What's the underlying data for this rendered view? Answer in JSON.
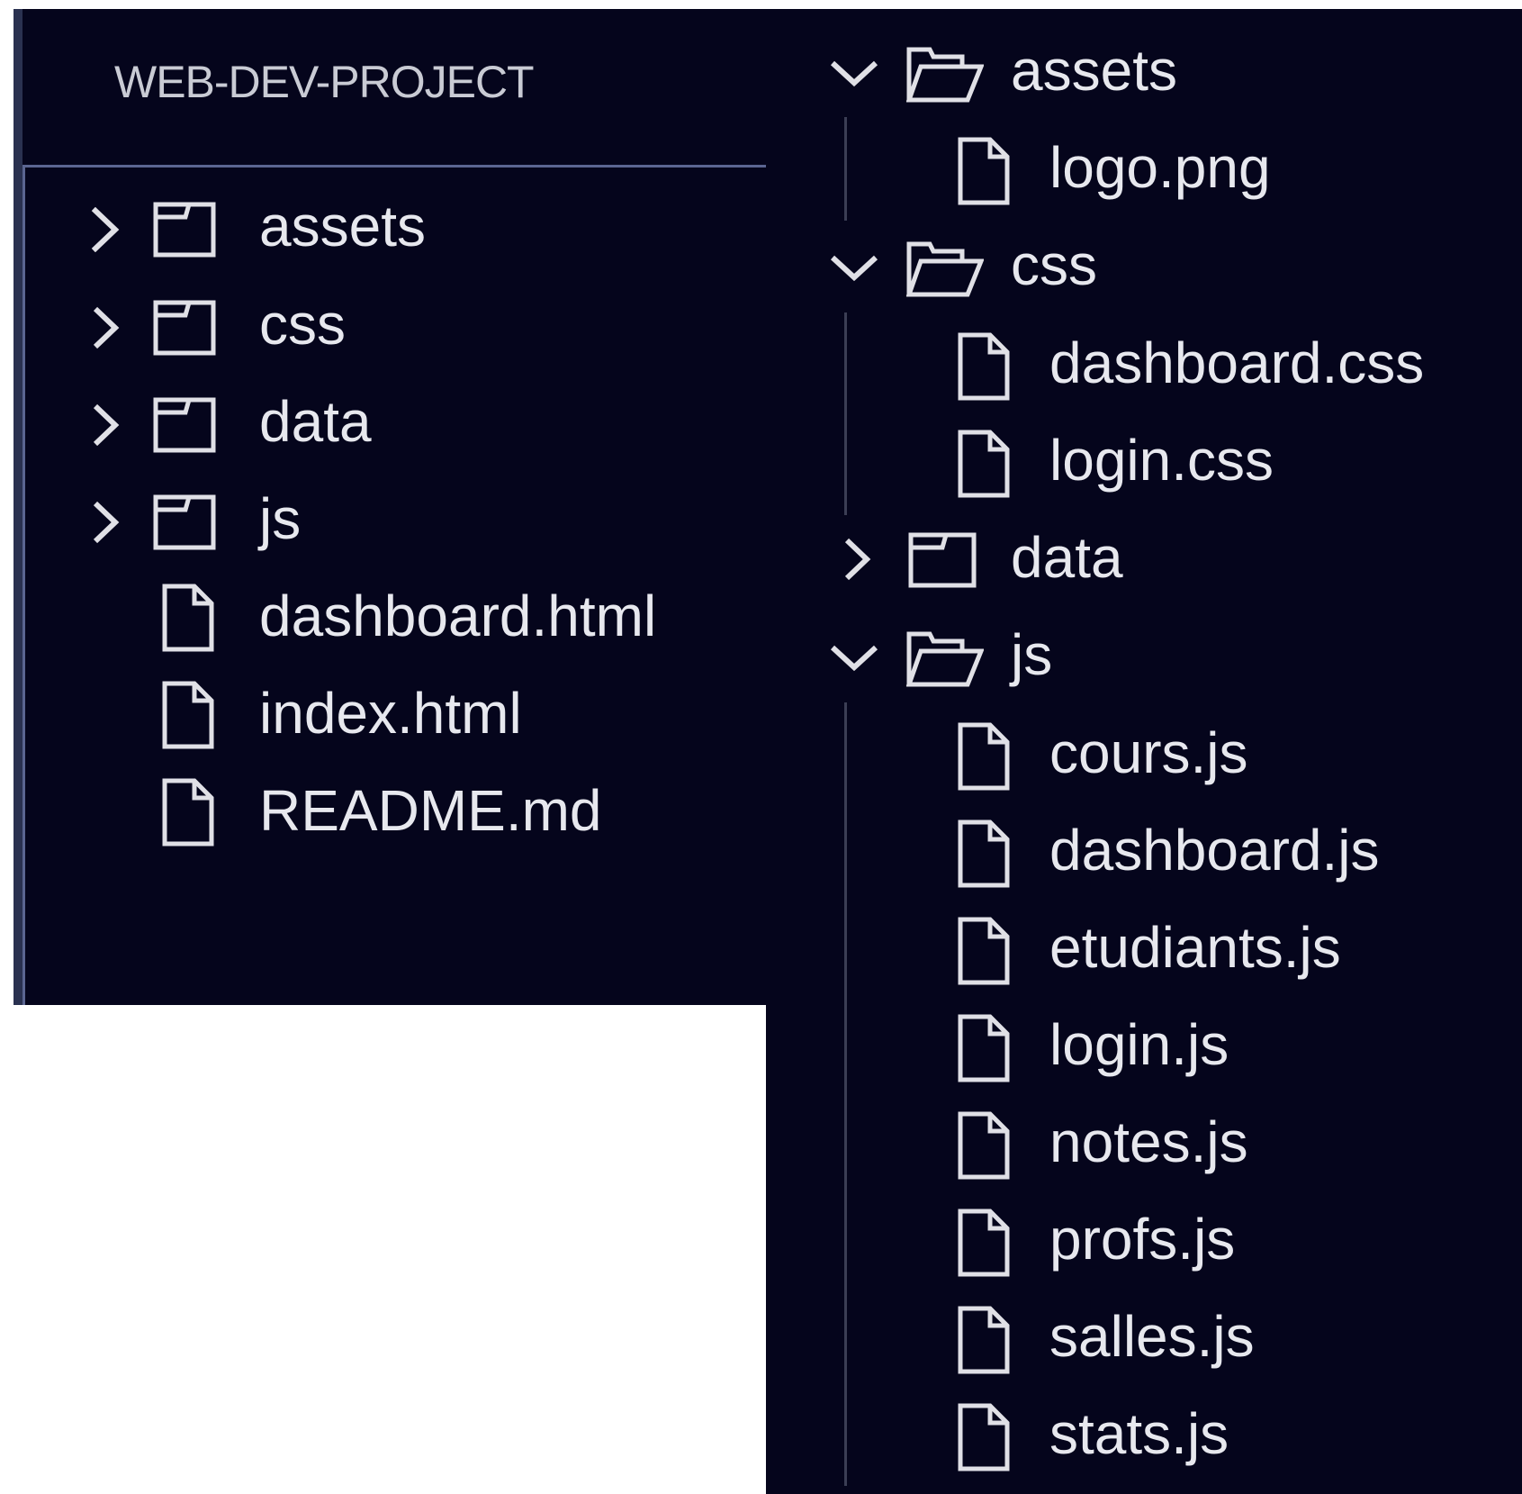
{
  "explorer": {
    "title": "WEB-DEV-PROJECT",
    "collapsed_tree": [
      {
        "label": "assets",
        "type": "folder",
        "expanded": false
      },
      {
        "label": "css",
        "type": "folder",
        "expanded": false
      },
      {
        "label": "data",
        "type": "folder",
        "expanded": false
      },
      {
        "label": "js",
        "type": "folder",
        "expanded": false
      },
      {
        "label": "dashboard.html",
        "type": "file"
      },
      {
        "label": "index.html",
        "type": "file"
      },
      {
        "label": "README.md",
        "type": "file"
      }
    ],
    "expanded_tree": [
      {
        "label": "assets",
        "type": "folder",
        "expanded": true,
        "children": [
          {
            "label": "logo.png",
            "type": "file"
          }
        ]
      },
      {
        "label": "css",
        "type": "folder",
        "expanded": true,
        "children": [
          {
            "label": "dashboard.css",
            "type": "file"
          },
          {
            "label": "login.css",
            "type": "file"
          }
        ]
      },
      {
        "label": "data",
        "type": "folder",
        "expanded": false
      },
      {
        "label": "js",
        "type": "folder",
        "expanded": true,
        "children": [
          {
            "label": "cours.js",
            "type": "file"
          },
          {
            "label": "dashboard.js",
            "type": "file"
          },
          {
            "label": "etudiants.js",
            "type": "file"
          },
          {
            "label": "login.js",
            "type": "file"
          },
          {
            "label": "notes.js",
            "type": "file"
          },
          {
            "label": "profs.js",
            "type": "file"
          },
          {
            "label": "salles.js",
            "type": "file"
          },
          {
            "label": "stats.js",
            "type": "file"
          }
        ]
      }
    ]
  },
  "icons": {
    "folder_closed": "folder-icon",
    "folder_open": "folder-open-icon",
    "file": "file-icon",
    "collapsed": "chevron-right-icon",
    "expanded": "chevron-down-icon"
  },
  "colors": {
    "panel_bg": "#05051c",
    "text": "#e7e8ee",
    "title_text": "#c9cbd4",
    "icon_stroke": "#e0e0e6",
    "focus_border": "#5b6591",
    "indent_guide": "#3b3e54"
  }
}
